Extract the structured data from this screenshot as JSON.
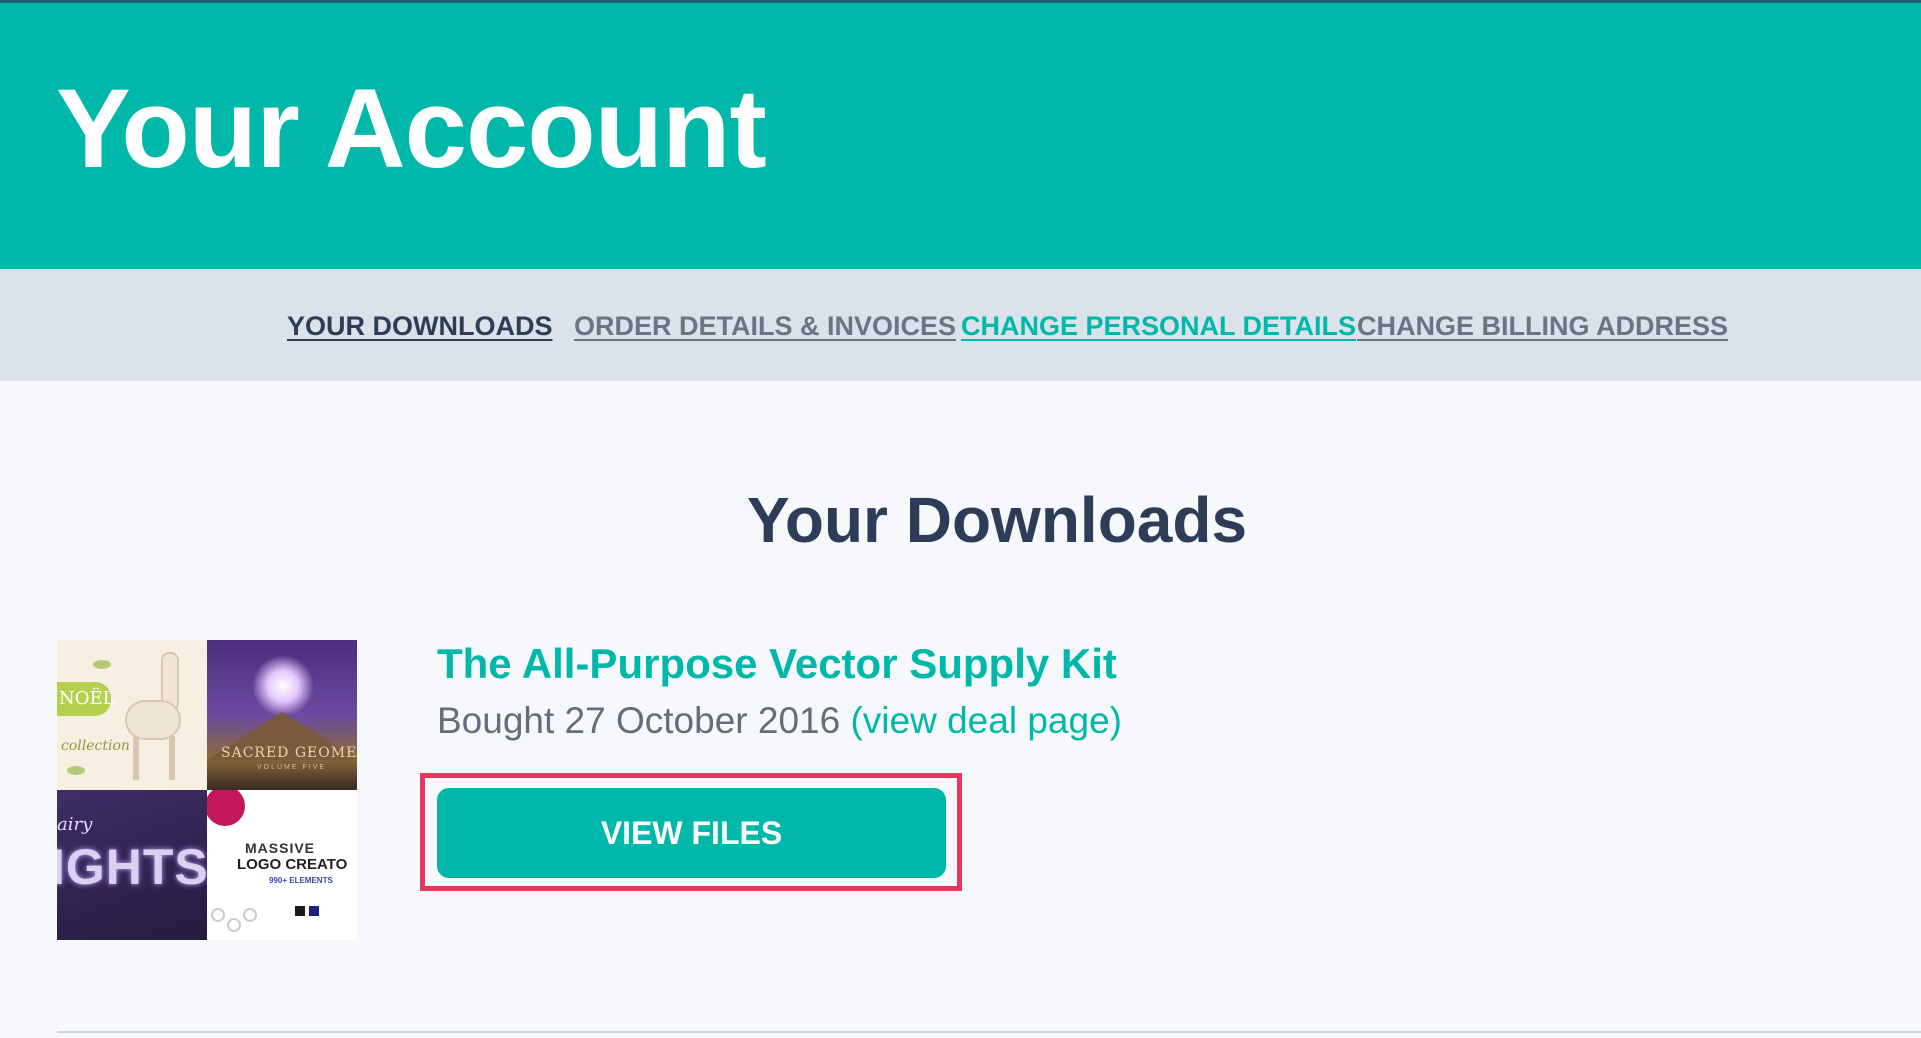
{
  "header": {
    "title": "Your Account"
  },
  "nav": {
    "items": [
      {
        "label": "YOUR DOWNLOADS"
      },
      {
        "label": "ORDER DETAILS & INVOICES"
      },
      {
        "label": "CHANGE PERSONAL DETAILS"
      },
      {
        "label": "CHANGE BILLING ADDRESS"
      }
    ]
  },
  "main": {
    "section_title": "Your Downloads",
    "product": {
      "title": "The All-Purpose Vector Supply Kit",
      "bought_prefix": "Bought 27 October 2016",
      "deal_link": "(view deal page)",
      "view_files_label": "VIEW FILES",
      "thumbnails": {
        "noel_badge": "NOËL",
        "noel_script": "collection",
        "geo_caption": "SACRED GEOMETR",
        "geo_sub": "VOLUME FIVE",
        "lights_word": "IGHTS",
        "lights_cursive": "airy",
        "logo_t1": "MASSIVE",
        "logo_t2": "LOGO CREATO",
        "logo_t3": "990+ ELEMENTS"
      }
    }
  },
  "colors": {
    "brand_teal": "#00b8a9",
    "nav_background": "#dce2ea",
    "heading_navy": "#2d3d57",
    "highlight_red": "#e8385f"
  }
}
